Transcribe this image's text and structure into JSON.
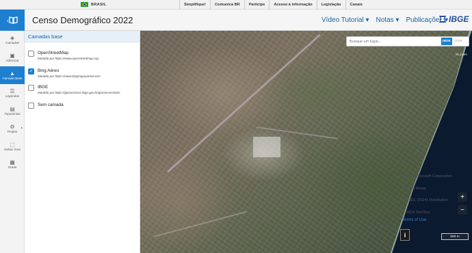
{
  "gov_bar": {
    "country": "BRASIL",
    "links": [
      "Simplifique!",
      "Comunica BR",
      "Participe",
      "Acesso à informação",
      "Legislação",
      "Canais"
    ]
  },
  "header": {
    "title": "Censo Demográfico 2022",
    "nav": [
      "Vídeo Tutorial ▾",
      "Notas ▾",
      "Publicações ▾"
    ],
    "brand": "IBGE"
  },
  "sidebar": {
    "items": [
      {
        "label": "Camadas",
        "icon": "layers-icon"
      },
      {
        "label": "Adicionar",
        "icon": "add-image-icon"
      },
      {
        "label": "Camada Base",
        "icon": "mountain-icon",
        "active": true
      },
      {
        "label": "Legendas",
        "icon": "list-icon"
      },
      {
        "label": "Toponimias",
        "icon": "toponym-icon"
      },
      {
        "label": "Projeto",
        "icon": "gear-icon"
      },
      {
        "label": "Salvar Área",
        "icon": "save-area-icon"
      },
      {
        "label": "Grade",
        "icon": "grid-icon"
      }
    ]
  },
  "panel": {
    "title": "Camadas base",
    "layers": [
      {
        "name": "OpenStreetMap",
        "source": "Mantido por https://www.openstreetmap.org",
        "checked": false
      },
      {
        "name": "Bing Aéreo",
        "source": "Mantido por https://www.bingmapsportal.com",
        "checked": true
      },
      {
        "name": "IBGE",
        "source": "Mantido por https://geoservicos.ibge.gov.br/geoserver/web/",
        "checked": false
      },
      {
        "name": "Sem camada",
        "source": "",
        "checked": false
      }
    ]
  },
  "map": {
    "search_placeholder": "Busque um lugar...",
    "search_ibge": "IBGE",
    "search_osm": "OSM",
    "no_zoom": "No zoom",
    "attribution": [
      "© 2024 Microsoft Corporation",
      "© 2024 Maxar",
      "©CNES (2024) Distribution",
      "© 2024 TomTom"
    ],
    "terms": "Terms of Use",
    "info": "i",
    "zoom_in": "+",
    "zoom_out": "−",
    "scale": "500 m"
  }
}
